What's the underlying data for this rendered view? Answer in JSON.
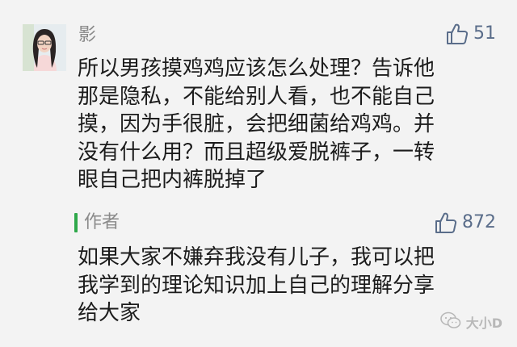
{
  "comment": {
    "username": "影",
    "likes": "51",
    "lines": [
      "所以男孩摸鸡鸡应该怎么处理？告诉他",
      "那是隐私，不能给别人看，也不能自己",
      "摸，因为手很脏，会把细菌给鸡鸡。并",
      "没有什么用？而且超级爱脱裤子，一转",
      "眼自己把内裤脱掉了"
    ]
  },
  "reply": {
    "author_label": "作者",
    "likes": "872",
    "lines": [
      "如果大家不嫌弃我没有儿子，我可以把",
      "我学到的理论知识加上自己的理解分享",
      "给大家"
    ]
  },
  "watermark": {
    "text": "大小D"
  },
  "colors": {
    "background": "#f3f3f3",
    "like_icon": "#5a6d8a",
    "author_accent": "#2ea84a",
    "meta_text": "#8a8a8a"
  },
  "icons": {
    "like": "thumbs-up-icon",
    "watermark": "wechat-logo-icon"
  }
}
